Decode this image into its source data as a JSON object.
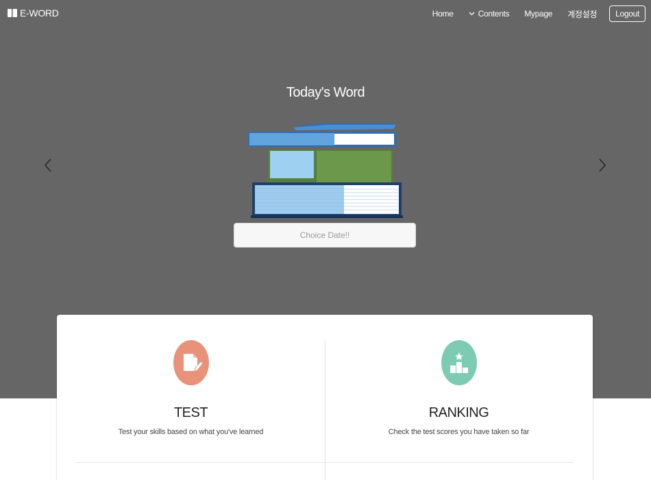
{
  "brand": {
    "name": "E-WORD",
    "icon": "book-icon"
  },
  "nav": {
    "home": "Home",
    "contents": "Contents",
    "mypage": "Mypage",
    "account_settings": "계정설정",
    "logout": "Logout"
  },
  "hero": {
    "title": "Today's Word",
    "date_button": "Choice Date!!"
  },
  "features": {
    "test": {
      "title": "TEST",
      "description": "Test your skills based on what you've learned",
      "icon": "document-pencil-icon",
      "color": "#e8927a"
    },
    "ranking": {
      "title": "RANKING",
      "description": "Check the test scores you have taken so far",
      "icon": "podium-icon",
      "color": "#7dcbb2"
    }
  },
  "colors": {
    "hero_bg": "#666666",
    "book_blue": "#5aa0dc",
    "book_green": "#6a974a",
    "book_navy": "#1f3f6b"
  }
}
